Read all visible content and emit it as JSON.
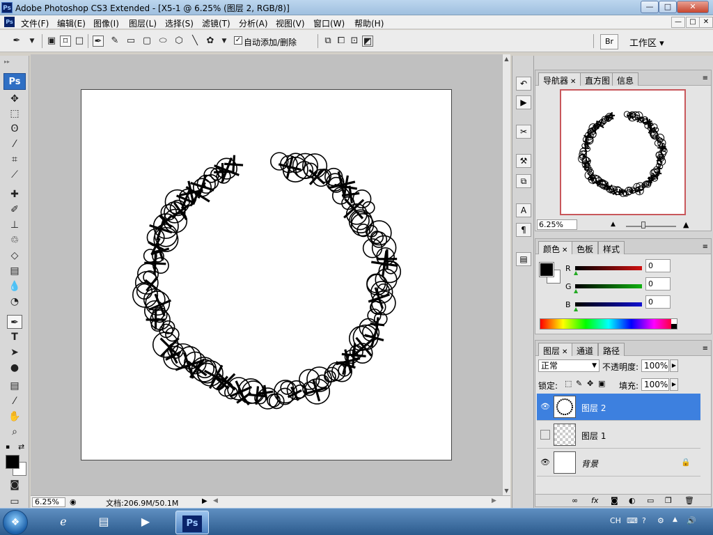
{
  "window": {
    "app_badge": "Ps",
    "title": "Adobe Photoshop CS3 Extended - [X5-1 @ 6.25% (图层 2, RGB/8)]",
    "min_glyph": "—",
    "max_glyph": "□",
    "close_glyph": "✕"
  },
  "menu": {
    "items": [
      "文件(F)",
      "编辑(E)",
      "图像(I)",
      "图层(L)",
      "选择(S)",
      "滤镜(T)",
      "分析(A)",
      "视图(V)",
      "窗口(W)",
      "帮助(H)"
    ]
  },
  "options": {
    "auto_add_delete_checked": "✓",
    "auto_add_delete_label": "自动添加/删除",
    "workspace_label": "工作区 ▾",
    "bridge_glyph": "Br"
  },
  "toolbox": {
    "logo": "Ps",
    "tools": [
      "move",
      "marquee",
      "lasso",
      "magic-wand",
      "crop",
      "slice",
      "healing",
      "brush",
      "stamp",
      "history-brush",
      "eraser",
      "gradient",
      "blur",
      "dodge",
      "pen",
      "type",
      "path-select",
      "shape",
      "notes",
      "eyedropper",
      "hand",
      "zoom"
    ],
    "active_tool": "pen",
    "foreground_color": "#000000",
    "background_color": "#ffffff"
  },
  "document": {
    "zoom": "6.25%",
    "doc_size": "文档:206.9M/50.1M"
  },
  "navigator": {
    "tabs": [
      {
        "label": "导航器",
        "close": "✕"
      },
      {
        "label": "直方图"
      },
      {
        "label": "信息"
      }
    ],
    "zoom": "6.25%"
  },
  "color": {
    "tabs": [
      {
        "label": "颜色",
        "close": "✕"
      },
      {
        "label": "色板"
      },
      {
        "label": "样式"
      }
    ],
    "channels": [
      {
        "name": "R",
        "value": "0",
        "color": "#d01010"
      },
      {
        "name": "G",
        "value": "0",
        "color": "#10b010"
      },
      {
        "name": "B",
        "value": "0",
        "color": "#1010d0"
      }
    ]
  },
  "layers": {
    "tabs": [
      {
        "label": "图层",
        "close": "✕"
      },
      {
        "label": "通道"
      },
      {
        "label": "路径"
      }
    ],
    "blend_mode": "正常",
    "opacity_label": "不透明度:",
    "opacity": "100%",
    "lock_label": "锁定:",
    "fill_label": "填充:",
    "fill": "100%",
    "items": [
      {
        "name": "图层 2",
        "visible": true,
        "selected": true
      },
      {
        "name": "图层 1",
        "visible": false,
        "selected": false
      },
      {
        "name": "背景",
        "visible": true,
        "selected": false,
        "locked": true
      }
    ]
  },
  "taskbar": {
    "ps_label": "Ps",
    "lang": "CH"
  }
}
